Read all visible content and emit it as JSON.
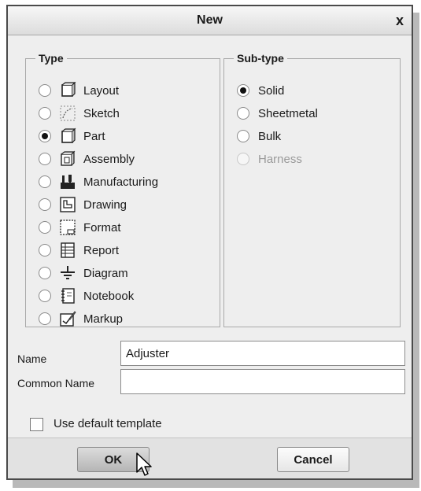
{
  "dialog": {
    "title": "New",
    "close_label": "x"
  },
  "type_group": {
    "legend": "Type",
    "items": [
      {
        "label": "Layout",
        "icon": "layout-icon",
        "checked": false
      },
      {
        "label": "Sketch",
        "icon": "sketch-icon",
        "checked": false
      },
      {
        "label": "Part",
        "icon": "part-icon",
        "checked": true
      },
      {
        "label": "Assembly",
        "icon": "assembly-icon",
        "checked": false
      },
      {
        "label": "Manufacturing",
        "icon": "manufacturing-icon",
        "checked": false
      },
      {
        "label": "Drawing",
        "icon": "drawing-icon",
        "checked": false
      },
      {
        "label": "Format",
        "icon": "format-icon",
        "checked": false
      },
      {
        "label": "Report",
        "icon": "report-icon",
        "checked": false
      },
      {
        "label": "Diagram",
        "icon": "diagram-icon",
        "checked": false
      },
      {
        "label": "Notebook",
        "icon": "notebook-icon",
        "checked": false
      },
      {
        "label": "Markup",
        "icon": "markup-icon",
        "checked": false
      }
    ]
  },
  "subtype_group": {
    "legend": "Sub-type",
    "items": [
      {
        "label": "Solid",
        "checked": true,
        "enabled": true
      },
      {
        "label": "Sheetmetal",
        "checked": false,
        "enabled": true
      },
      {
        "label": "Bulk",
        "checked": false,
        "enabled": true
      },
      {
        "label": "Harness",
        "checked": false,
        "enabled": false
      }
    ]
  },
  "fields": {
    "name_label": "Name",
    "name_value": "Adjuster",
    "common_name_label": "Common Name",
    "common_name_value": ""
  },
  "options": {
    "use_default_template_label": "Use default template",
    "use_default_template_checked": false
  },
  "buttons": {
    "ok_label": "OK",
    "cancel_label": "Cancel"
  },
  "colors": {
    "dialog_bg": "#eeeeee",
    "border": "#4a4a4a",
    "disabled_text": "#9a9a9a"
  }
}
